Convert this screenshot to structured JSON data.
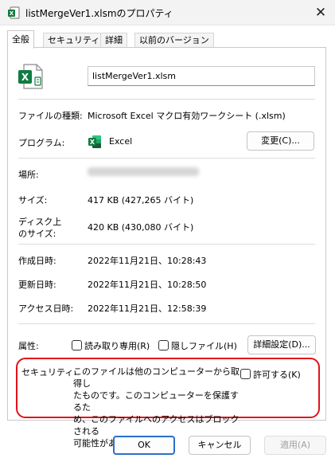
{
  "window": {
    "title": "listMergeVer1.xlsmのプロパティ",
    "close_glyph": "✕"
  },
  "tabs": [
    {
      "label": "全般",
      "active": true
    },
    {
      "label": "セキュリティ",
      "active": false
    },
    {
      "label": "詳細",
      "active": false
    },
    {
      "label": "以前のバージョン",
      "active": false
    }
  ],
  "general": {
    "file_name": "listMergeVer1.xlsm",
    "file_type_label": "ファイルの種類:",
    "file_type_value": "Microsoft Excel マクロ有効ワークシート (.xlsm)",
    "program_label": "プログラム:",
    "program_value": "Excel",
    "change_button": "変更(C)...",
    "location_label": "場所:",
    "size_label": "サイズ:",
    "size_value": "417 KB (427,265 バイト)",
    "disk_size_label_1": "ディスク上",
    "disk_size_label_2": "のサイズ:",
    "disk_size_value": "420 KB (430,080 バイト)",
    "created_label": "作成日時:",
    "created_value": "2022年11月21日、10:28:43",
    "modified_label": "更新日時:",
    "modified_value": "2022年11月21日、10:28:50",
    "accessed_label": "アクセス日時:",
    "accessed_value": "2022年11月21日、12:58:39",
    "attributes_label": "属性:",
    "readonly_label": "読み取り専用(R)",
    "hidden_label": "隠しファイル(H)",
    "advanced_button": "詳細設定(D)...",
    "security_label": "セキュリティ:",
    "security_lines": [
      "このファイルは他のコンピューターから取得し",
      "たものです。このコンピューターを保護するた",
      "め、このファイルへのアクセスはブロックされる",
      "可能性があります。"
    ],
    "unblock_label": "許可する(K)"
  },
  "footer": {
    "ok": "OK",
    "cancel": "キャンセル",
    "apply": "適用(A)"
  },
  "colors": {
    "excel_green": "#107c41",
    "highlight_red": "#e0121a",
    "primary_border": "#2a6fc9"
  }
}
